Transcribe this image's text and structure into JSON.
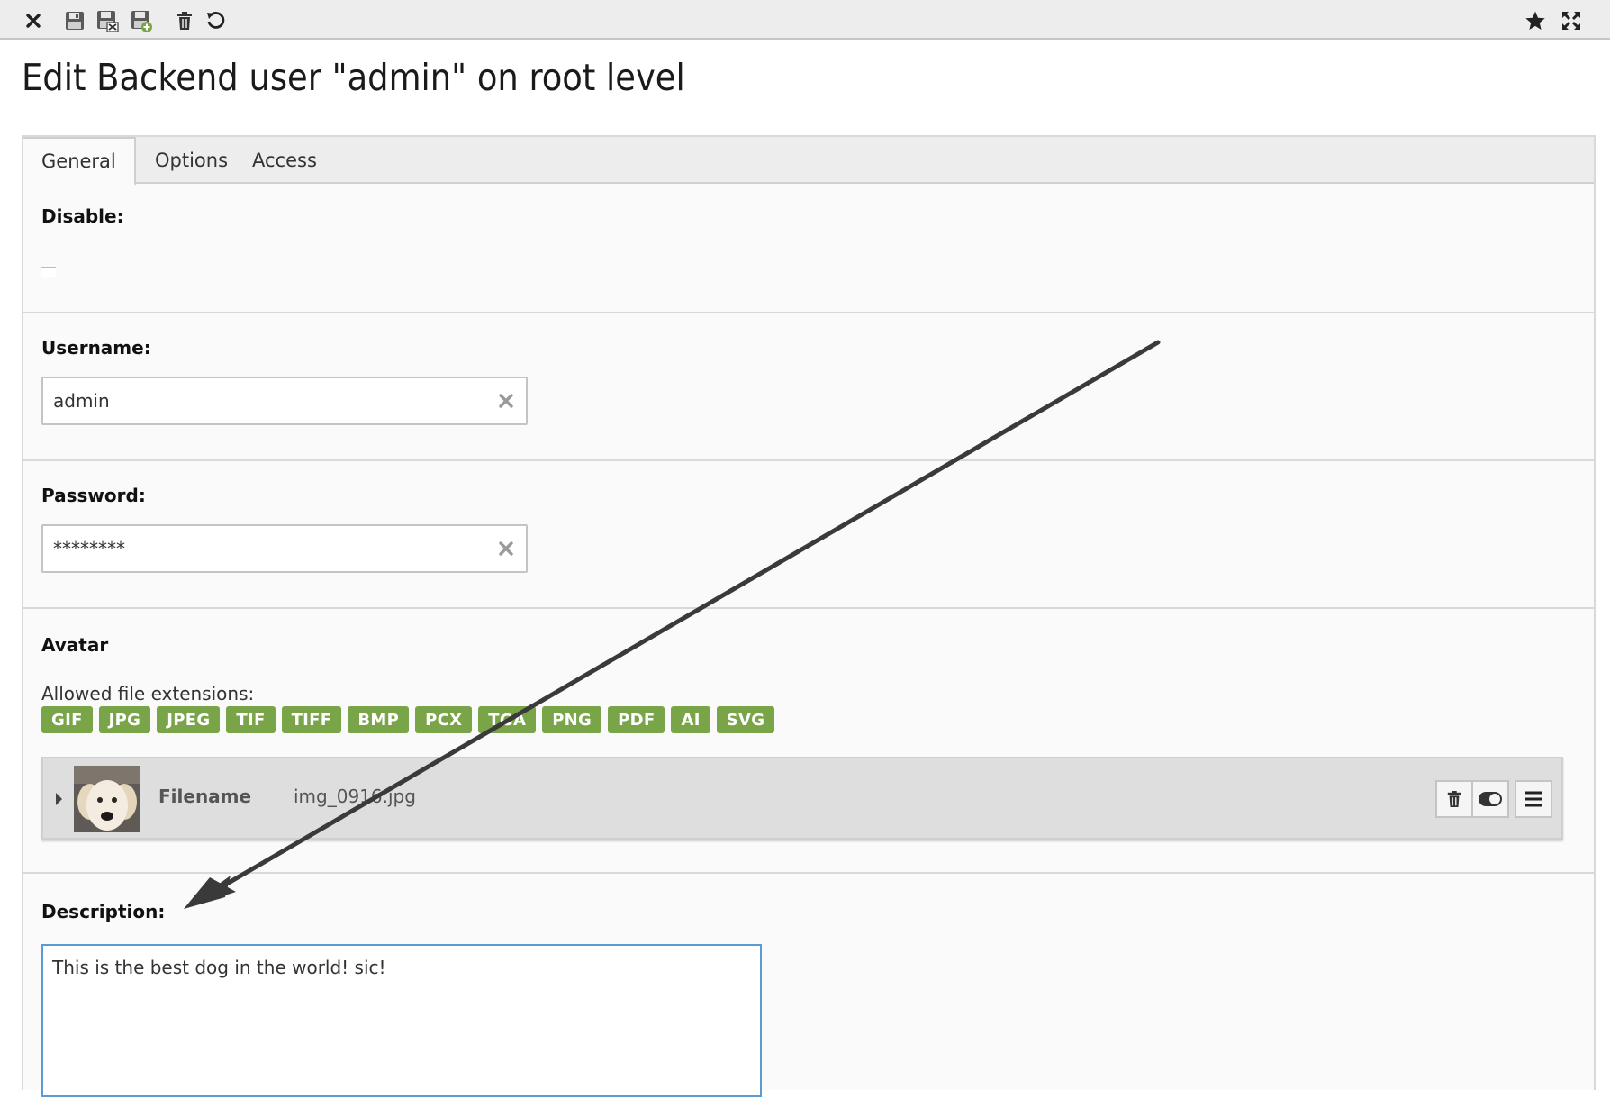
{
  "toolbar": {
    "left_buttons": [
      "close-icon",
      "save-icon",
      "save-and-close-icon",
      "save-and-new-icon",
      "delete-icon",
      "undo-icon"
    ],
    "right_buttons": [
      "star-icon",
      "fullscreen-icon"
    ]
  },
  "page": {
    "title": "Edit Backend user \"admin\" on root level"
  },
  "tabs": [
    {
      "label": "General",
      "active": true
    },
    {
      "label": "Options",
      "active": false
    },
    {
      "label": "Access",
      "active": false
    }
  ],
  "form": {
    "disable": {
      "label": "Disable:",
      "checked": false
    },
    "username": {
      "label": "Username:",
      "value": "admin"
    },
    "password": {
      "label": "Password:",
      "value": "********"
    },
    "avatar": {
      "label": "Avatar",
      "allowed_caption": "Allowed file extensions:",
      "extensions": [
        "GIF",
        "JPG",
        "JPEG",
        "TIF",
        "TIFF",
        "BMP",
        "PCX",
        "TGA",
        "PNG",
        "PDF",
        "AI",
        "SVG"
      ],
      "file": {
        "label": "Filename",
        "name": "img_0916.jpg"
      }
    },
    "description": {
      "label": "Description:",
      "value": "This is the best dog in the world! sic!"
    }
  },
  "colors": {
    "badge": "#79a548",
    "textarea_focus": "#5b9bd5",
    "annotation_arrow": "#3a3a3a"
  }
}
